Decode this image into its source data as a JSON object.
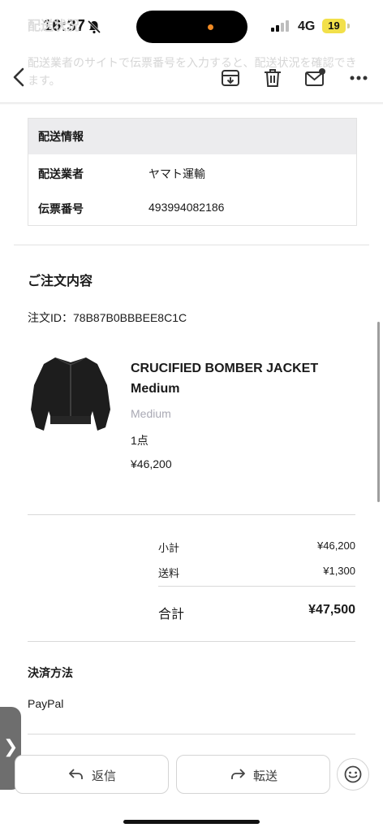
{
  "status_bar": {
    "time": "16:37",
    "network": "4G",
    "battery": "19"
  },
  "background_text": {
    "heading": "配送状況",
    "body": "配送業者のサイトで伝票番号を入力すると、配送状況を確認できます。"
  },
  "toolbar": {
    "icons": [
      "back-icon",
      "archive-icon",
      "trash-icon",
      "mail-icon",
      "more-icon"
    ]
  },
  "shipping": {
    "title": "配送情報",
    "carrier_label": "配送業者",
    "carrier_value": "ヤマト運輸",
    "tracking_label": "伝票番号",
    "tracking_value": "493994082186"
  },
  "order": {
    "title": "ご注文内容",
    "order_id": "注文ID：78B87B0BBBEE8C1C",
    "product": {
      "name": "CRUCIFIED BOMBER JACKET Medium",
      "variant": "Medium",
      "quantity": "1点",
      "price": "¥46,200"
    }
  },
  "summary": {
    "subtotal_label": "小計",
    "subtotal_value": "¥46,200",
    "shipping_label": "送料",
    "shipping_value": "¥1,300",
    "total_label": "合計",
    "total_value": "¥47,500"
  },
  "payment": {
    "title": "決済方法",
    "method": "PayPal"
  },
  "actions": {
    "reply_label": "返信",
    "forward_label": "転送"
  },
  "side_tab": {
    "glyph": "❯"
  },
  "colors": {
    "battery": "#f2e04a",
    "island_dot": "#f08a24",
    "table_header": "#ececee"
  }
}
